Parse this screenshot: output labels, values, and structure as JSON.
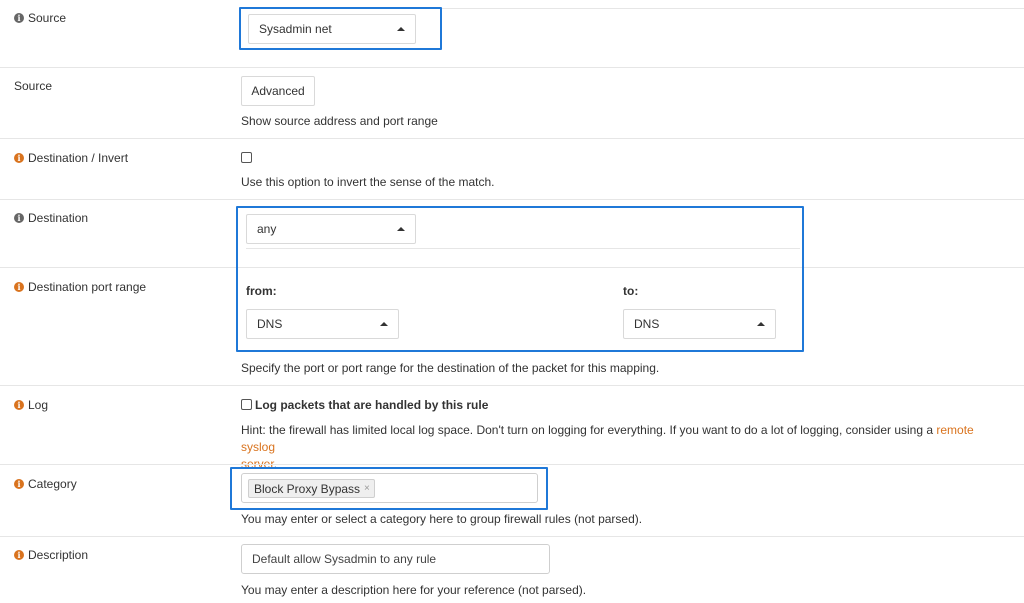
{
  "source": {
    "label": "Source",
    "selected": "Sysadmin net"
  },
  "source_advanced": {
    "label": "Source",
    "button": "Advanced",
    "help": "Show source address and port range"
  },
  "destination_invert": {
    "label": "Destination / Invert",
    "help": "Use this option to invert the sense of the match."
  },
  "destination": {
    "label": "Destination",
    "selected": "any"
  },
  "destination_port_range": {
    "label": "Destination port range",
    "from_label": "from:",
    "from_value": "DNS",
    "to_label": "to:",
    "to_value": "DNS",
    "help": "Specify the port or port range for the destination of the packet for this mapping."
  },
  "log": {
    "label": "Log",
    "checkbox_label": "Log packets that are handled by this rule",
    "hint_before": "Hint: the firewall has limited local log space. Don't turn on logging for everything. If you want to do a lot of logging, consider using a ",
    "hint_link_line1": "remote syslog",
    "hint_link_line2": "server",
    "hint_after": "."
  },
  "category": {
    "label": "Category",
    "tag": "Block Proxy Bypass",
    "tag_remove": "×",
    "help": "You may enter or select a category here to group firewall rules (not parsed)."
  },
  "description": {
    "label": "Description",
    "value": "Default allow Sysadmin to any rule",
    "help": "You may enter a description here for your reference (not parsed)."
  },
  "colors": {
    "highlight": "#1f78d8",
    "info_icon_orange": "#d9731e",
    "info_icon_gray": "#666666",
    "link": "#d9731e"
  }
}
